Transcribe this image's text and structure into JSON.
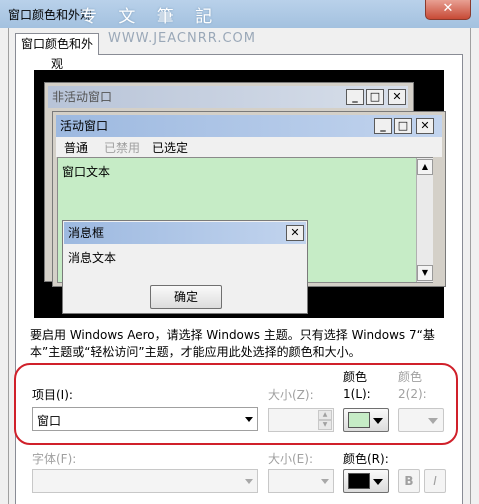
{
  "window": {
    "title": "窗口颜色和外观",
    "close_label": "✕",
    "watermark": "专 文 筆 記",
    "watermark_url": "WWW.JEACNRR.COM"
  },
  "tabs": [
    {
      "label": "窗口颜色和外观"
    }
  ],
  "preview": {
    "inactive_title": "非活动窗口",
    "active_title": "活动窗口",
    "menu": {
      "normal": "普通",
      "disabled": "已禁用",
      "selected": "已选定"
    },
    "window_text": "窗口文本",
    "message_box_title": "消息框",
    "message_text": "消息文本",
    "ok_label": "确定",
    "ctl_min": "_",
    "ctl_max": "□",
    "ctl_close": "✕",
    "scroll_up": "▲",
    "scroll_down": "▼"
  },
  "notice": "要启用 Windows Aero，请选择 Windows 主题。只有选择 Windows 7“基本”主题或“轻松访问”主题，才能应用此处选择的颜色和大小。",
  "item": {
    "label": "项目(I):",
    "value": "窗口",
    "size_label": "大小(Z):",
    "size_value": "",
    "color1_label": "颜色 1(L):",
    "color1_value": "#c6ecc6",
    "color2_label": "颜色 2(2):"
  },
  "font": {
    "label": "字体(F):",
    "value": "",
    "size_label": "大小(E):",
    "color_label": "颜色(R):",
    "color_value": "#000000",
    "bold_label": "B",
    "italic_label": "I"
  },
  "colors": {
    "title_gradient": "#b9d1ea",
    "highlight_ring": "#d0202a",
    "window_bg": "#c6ecc6",
    "preview_bg": "#000000"
  }
}
